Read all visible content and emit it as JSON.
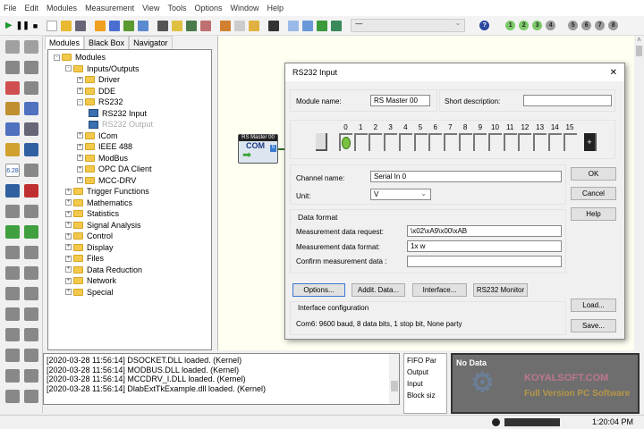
{
  "menu": [
    "File",
    "Edit",
    "Modules",
    "Measurement",
    "View",
    "Tools",
    "Options",
    "Window",
    "Help"
  ],
  "toolbar": {
    "combo_value": "—",
    "numbers": [
      "1",
      "2",
      "3",
      "4",
      "5",
      "6",
      "7",
      "8"
    ],
    "active_color": "#7cc96b",
    "inactive_color": "#9a9a9a"
  },
  "palette": {
    "display_value": "6.28"
  },
  "panel": {
    "tabs": [
      "Modules",
      "Black Box",
      "Navigator"
    ],
    "tree": [
      {
        "label": "Modules",
        "level": 0,
        "expander": "-"
      },
      {
        "label": "Inputs/Outputs",
        "level": 1,
        "expander": "-"
      },
      {
        "label": "Driver",
        "level": 2,
        "expander": "+"
      },
      {
        "label": "DDE",
        "level": 2,
        "expander": "+"
      },
      {
        "label": "RS232",
        "level": 2,
        "expander": "-"
      },
      {
        "label": "RS232 Input",
        "level": 3,
        "type": "module"
      },
      {
        "label": "RS232 Output",
        "level": 3,
        "type": "module",
        "disabled": true
      },
      {
        "label": "ICom",
        "level": 2,
        "expander": "+"
      },
      {
        "label": "IEEE 488",
        "level": 2,
        "expander": "+"
      },
      {
        "label": "ModBus",
        "level": 2,
        "expander": "+"
      },
      {
        "label": "OPC DA Client",
        "level": 2,
        "expander": "+"
      },
      {
        "label": "MCC-DRV",
        "level": 2,
        "expander": "+"
      },
      {
        "label": "Trigger Functions",
        "level": 1,
        "expander": "+"
      },
      {
        "label": "Mathematics",
        "level": 1,
        "expander": "+"
      },
      {
        "label": "Statistics",
        "level": 1,
        "expander": "+"
      },
      {
        "label": "Signal Analysis",
        "level": 1,
        "expander": "+"
      },
      {
        "label": "Control",
        "level": 1,
        "expander": "+"
      },
      {
        "label": "Display",
        "level": 1,
        "expander": "+"
      },
      {
        "label": "Files",
        "level": 1,
        "expander": "+"
      },
      {
        "label": "Data Reduction",
        "level": 1,
        "expander": "+"
      },
      {
        "label": "Network",
        "level": 1,
        "expander": "+"
      },
      {
        "label": "Special",
        "level": 1,
        "expander": "+"
      }
    ]
  },
  "canvas": {
    "block_title": "RS Master 00",
    "block_label": "COM",
    "block_port": "0"
  },
  "dialog": {
    "title": "RS232 Input",
    "close": "✕",
    "module_name_label": "Module name:",
    "module_name": "RS Master 00",
    "short_desc_label": "Short description:",
    "short_desc": "",
    "channels": [
      "0",
      "1",
      "2",
      "3",
      "4",
      "5",
      "6",
      "7",
      "8",
      "9",
      "10",
      "11",
      "12",
      "13",
      "14",
      "15"
    ],
    "prev": "-",
    "next": "+",
    "channel_name_label": "Channel name:",
    "channel_name": "Serial In 0",
    "unit_label": "Unit:",
    "unit": "V",
    "data_format_title": "Data format",
    "request_label": "Measurement data request:",
    "request": "\\x02\\xA9\\x00\\xAB",
    "format_label": "Measurement data format:",
    "format": "1x w",
    "confirm_label": "Confirm measurement data :",
    "confirm": "",
    "buttons": {
      "options": "Options...",
      "addit": "Addit. Data...",
      "interface": "Interface...",
      "monitor": "RS232 Monitor",
      "ok": "OK",
      "cancel": "Cancel",
      "help": "Help",
      "load": "Load...",
      "save": "Save..."
    },
    "iface_title": "Interface configuration",
    "iface_text": "Com6: 9600 baud, 8 data bits, 1 stop bit, None party"
  },
  "log": [
    "[2020-03-28 11:56:14] DSOCKET.DLL loaded. (Kernel)",
    "[2020-03-28 11:56:14] MODBUS.DLL loaded. (Kernel)",
    "[2020-03-28 11:56:14] MCCDRV_I.DLL loaded. (Kernel)",
    "[2020-03-28 11:56:14] DlabExtTkExample.dll loaded. (Kernel)"
  ],
  "fifo": [
    "FIFO Par",
    "Output",
    "Input",
    "Block siz"
  ],
  "preview": {
    "text": "No Data",
    "watermark_1": "KOYALSOFT.COM",
    "watermark_2": "Full Version PC Software"
  },
  "status": {
    "time": "1:20:04 PM"
  }
}
